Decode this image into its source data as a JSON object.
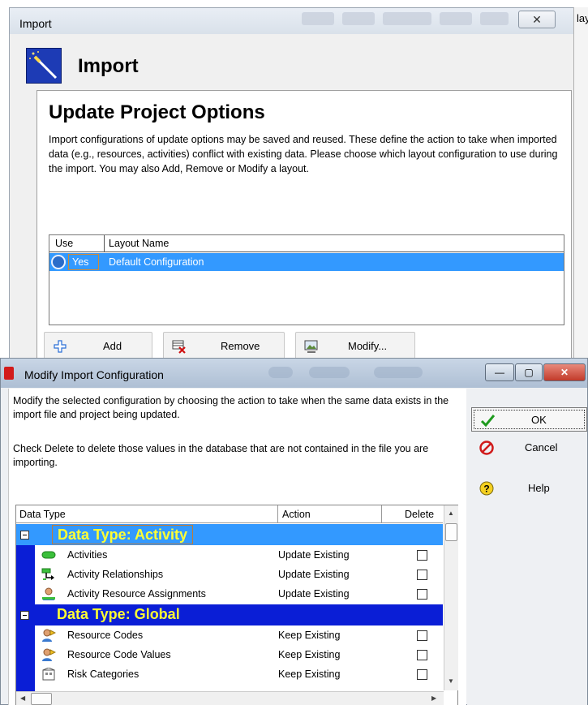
{
  "import_window": {
    "title": "Import",
    "close_glyph": "✕",
    "right_edge_text": "lay",
    "heading": "Import",
    "panel": {
      "title": "Update Project Options",
      "description": "Import configurations of update options may be saved and reused.  These define the action to take when imported data (e.g., resources, activities) conflict with existing data.  Please choose which layout configuration to use during the import. You may also Add, Remove or Modify a layout."
    },
    "layout_table": {
      "col_use": "Use",
      "col_layout_name": "Layout Name",
      "rows": [
        {
          "use": "Yes",
          "layout_name": "Default Configuration",
          "selected": true
        }
      ]
    },
    "buttons": {
      "add": "Add",
      "remove": "Remove",
      "modify": "Modify..."
    }
  },
  "modify_dialog": {
    "title": "Modify Import Configuration",
    "window_controls": {
      "minimize": "—",
      "maximize": "▢",
      "close": "✕"
    },
    "description1": "Modify the selected configuration by choosing the action to take when the same data exists in the import file and project being updated.",
    "description2": "Check Delete to delete those values in the database that are not contained in the file you are importing.",
    "grid": {
      "col_data_type": "Data Type",
      "col_action": "Action",
      "col_delete": "Delete",
      "groups": [
        {
          "label": "Data Type: Activity",
          "rows": [
            {
              "name": "Activities",
              "action": "Update Existing",
              "delete": false,
              "icon": "activity-bar-icon"
            },
            {
              "name": "Activity Relationships",
              "action": "Update Existing",
              "delete": false,
              "icon": "relationship-icon"
            },
            {
              "name": "Activity Resource Assignments",
              "action": "Update Existing",
              "delete": false,
              "icon": "resource-assignment-icon"
            }
          ]
        },
        {
          "label": "Data Type: Global",
          "rows": [
            {
              "name": "Resource Codes",
              "action": "Keep Existing",
              "delete": false,
              "icon": "resource-code-icon"
            },
            {
              "name": "Resource Code Values",
              "action": "Keep Existing",
              "delete": false,
              "icon": "resource-code-icon"
            },
            {
              "name": "Risk Categories",
              "action": "Keep Existing",
              "delete": false,
              "icon": "risk-category-icon"
            }
          ]
        }
      ]
    },
    "side_buttons": {
      "ok": "OK",
      "cancel": "Cancel",
      "help": "Help"
    }
  },
  "colors": {
    "selection_blue": "#3399ff",
    "group_bar_blue": "#0a1ed6",
    "group_label_yellow": "#ffff33",
    "wizard_icon_blue": "#1d3bb5"
  }
}
